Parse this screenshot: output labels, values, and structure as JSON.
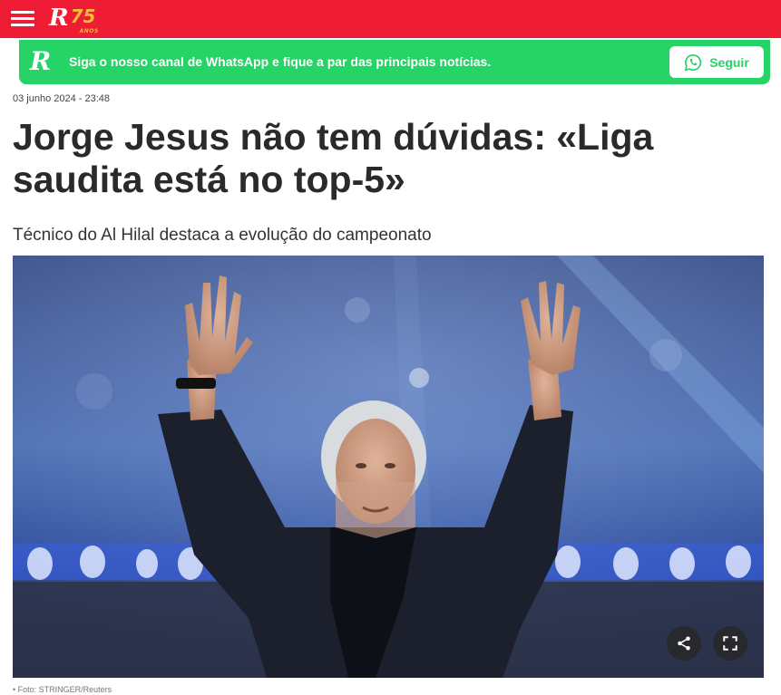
{
  "header": {
    "menu_icon": "hamburger-menu-icon",
    "logo": {
      "letter": "R",
      "number": "75",
      "tag": "ANOS"
    },
    "brand_color": "#ee1d35"
  },
  "whatsapp_banner": {
    "logo_letter": "R",
    "text": "Siga o nosso canal de WhatsApp e fique a par das principais notícias.",
    "button_label": "Seguir",
    "button_icon": "whatsapp-icon",
    "color": "#25d366"
  },
  "article": {
    "date": "03 junho 2024 - 23:48",
    "headline_line1": "Jorge Jesus não tem dúvidas: «Liga",
    "headline_line2": "saudita está no top-5»",
    "subtitle": "Técnico do Al Hilal destaca a evolução do campeonato",
    "photo_icons": [
      "share-icon",
      "fullscreen-icon"
    ],
    "caption": "• Foto: STRINGER/Reuters"
  }
}
